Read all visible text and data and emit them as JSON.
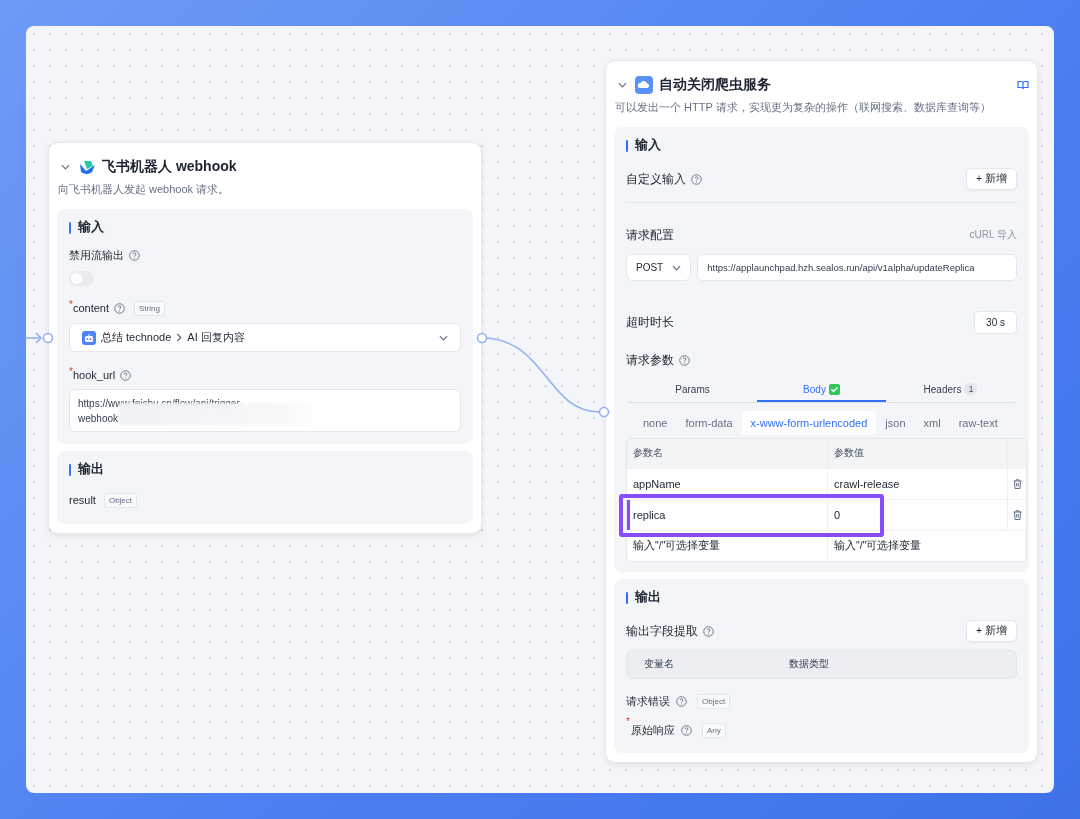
{
  "webhook_node": {
    "title": "飞书机器人 webhook",
    "description": "向飞书机器人发起 webhook 请求。",
    "input": {
      "heading": "输入",
      "fields": [
        {
          "kind": "toggle",
          "label": "禁用流输出",
          "on": false
        },
        {
          "kind": "select",
          "label": "content",
          "required_mark": "*",
          "type": "String",
          "source": "总结 technode",
          "value": "AI 回复内容"
        },
        {
          "kind": "text",
          "label": "hook_url",
          "required_mark": "*",
          "value": "https://www.feishu.cn/flow/api/trigger-webhook"
        }
      ]
    },
    "output": {
      "heading": "输出",
      "fields": [
        {
          "label": "result",
          "type": "Object"
        }
      ]
    }
  },
  "http_node": {
    "title": "自动关闭爬虫服务",
    "description": "可以发出一个 HTTP 请求，实现更为复杂的操作（联网搜索、数据库查询等）",
    "input": {
      "heading": "输入",
      "custom_input_label": "自定义输入",
      "add_button": "+ 新增",
      "request_config_label": "请求配置",
      "curl_import": "cURL 导入",
      "method": "POST",
      "url": "https://applaunchpad.hzh.sealos.run/api/v1alpha/updateReplica",
      "timeout_label": "超时时长",
      "timeout": "30 s",
      "params_label": "请求参数",
      "tabs": [
        {
          "label": "Params",
          "selected": false
        },
        {
          "label": "Body",
          "selected": true,
          "checked": true
        },
        {
          "label": "Headers",
          "selected": false,
          "count": "1"
        }
      ],
      "body_types": [
        {
          "label": "none",
          "selected": false
        },
        {
          "label": "form-data",
          "selected": false
        },
        {
          "label": "x-www-form-urlencoded",
          "selected": true
        },
        {
          "label": "json",
          "selected": false
        },
        {
          "label": "xml",
          "selected": false
        },
        {
          "label": "raw-text",
          "selected": false
        }
      ],
      "table": {
        "columns": [
          "参数名",
          "参数值"
        ],
        "rows": [
          {
            "name": "appName",
            "value": "crawl-release",
            "highlighted": false
          },
          {
            "name": "replica",
            "value": "0",
            "highlighted": true
          }
        ],
        "placeholders": [
          "输入\"/\"可选择变量",
          "输入\"/\"可选择变量"
        ]
      }
    },
    "output": {
      "heading": "输出",
      "extract_label": "输出字段提取",
      "add_button": "+ 新增",
      "columns": [
        "变量名",
        "数据类型"
      ],
      "fields": [
        {
          "label": "请求错误",
          "type": "Object"
        },
        {
          "label": "原始响应",
          "type": "Any",
          "required_mark": "*"
        }
      ]
    }
  }
}
